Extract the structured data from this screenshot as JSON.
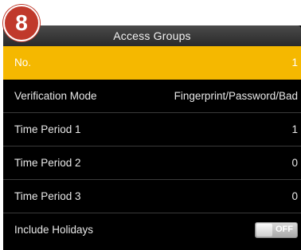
{
  "badge": "8",
  "header": {
    "title": "Access Groups"
  },
  "rows": [
    {
      "label": "No.",
      "value": "1"
    },
    {
      "label": "Verification Mode",
      "value": "Fingerprint/Password/Bad"
    },
    {
      "label": "Time Period 1",
      "value": "1"
    },
    {
      "label": "Time Period 2",
      "value": "0"
    },
    {
      "label": "Time Period 3",
      "value": "0"
    },
    {
      "label": "Include Holidays",
      "toggle_label": "OFF"
    }
  ],
  "colors": {
    "selected_row": "#f5b800",
    "badge": "#c0392b",
    "background": "#000000"
  }
}
